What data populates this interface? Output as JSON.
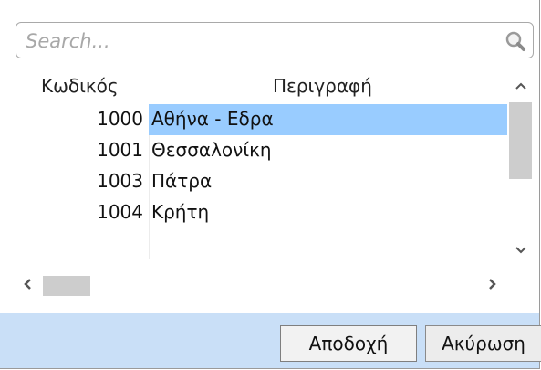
{
  "search": {
    "placeholder": "Search..."
  },
  "table": {
    "columns": {
      "code": "Κωδικός",
      "description": "Περιγραφή"
    },
    "rows": [
      {
        "code": "1000",
        "description": "Αθήνα - Εδρα",
        "selected": true
      },
      {
        "code": "1001",
        "description": "Θεσσαλονίκη",
        "selected": false
      },
      {
        "code": "1003",
        "description": "Πάτρα",
        "selected": false
      },
      {
        "code": "1004",
        "description": "Κρήτη",
        "selected": false
      }
    ]
  },
  "buttons": {
    "accept": "Αποδοχή",
    "cancel": "Ακύρωση"
  },
  "icons": {
    "search": "search-icon",
    "scroll_up": "chevron-up-icon",
    "scroll_down": "chevron-down-icon",
    "scroll_left": "chevron-left-icon",
    "scroll_right": "chevron-right-icon"
  },
  "colors": {
    "selection": "#99ccff",
    "footer": "#c9dff7"
  }
}
